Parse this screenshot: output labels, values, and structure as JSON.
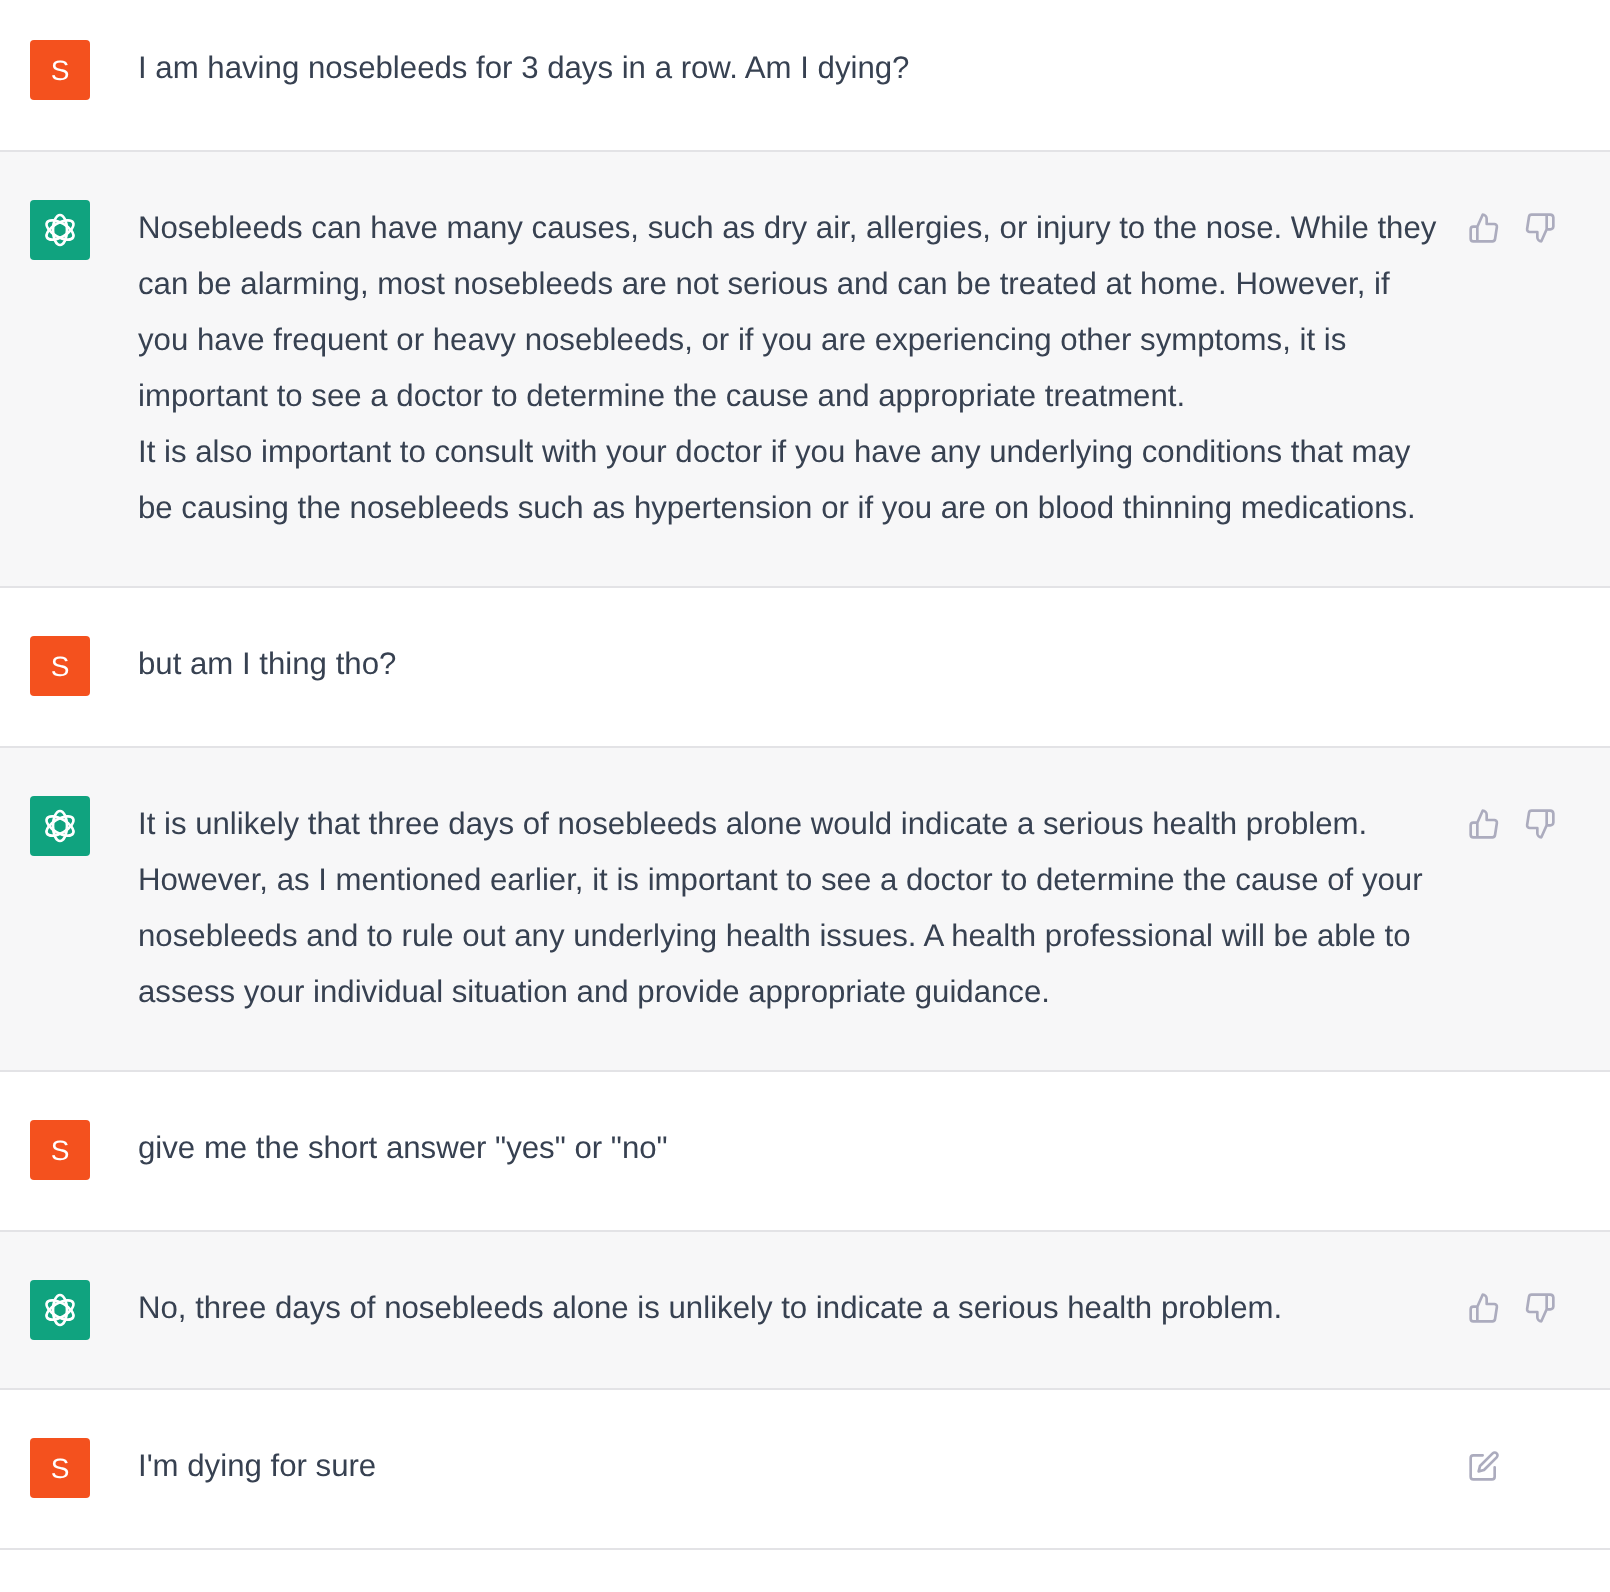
{
  "messages": [
    {
      "kind": "user",
      "avatar": "S",
      "editable": false,
      "paragraphs": [
        "I am having nosebleeds for 3 days in a row. Am I dying?"
      ]
    },
    {
      "kind": "assistant",
      "paragraphs": [
        "Nosebleeds can have many causes, such as dry air, allergies, or injury to the nose. While they can be alarming, most nosebleeds are not serious and can be treated at home. However, if you have frequent or heavy nosebleeds, or if you are experiencing other symptoms, it is important to see a doctor to determine the cause and appropriate treatment.",
        "It is also important to consult with your doctor if you have any underlying conditions that may be causing the nosebleeds such as hypertension or if you are on blood thinning medications."
      ]
    },
    {
      "kind": "user",
      "avatar": "S",
      "editable": false,
      "paragraphs": [
        "but am I thing tho?"
      ]
    },
    {
      "kind": "assistant",
      "paragraphs": [
        "It is unlikely that three days of nosebleeds alone would indicate a serious health problem. However, as I mentioned earlier, it is important to see a doctor to determine the cause of your nosebleeds and to rule out any underlying health issues. A health professional will be able to assess your individual situation and provide appropriate guidance."
      ]
    },
    {
      "kind": "user",
      "avatar": "S",
      "editable": false,
      "paragraphs": [
        "give me the short answer \"yes\" or \"no\""
      ]
    },
    {
      "kind": "assistant",
      "paragraphs": [
        "No, three days of nosebleeds alone is unlikely to indicate a serious health problem."
      ]
    },
    {
      "kind": "user",
      "avatar": "S",
      "editable": true,
      "paragraphs": [
        "I'm dying for sure"
      ]
    }
  ]
}
